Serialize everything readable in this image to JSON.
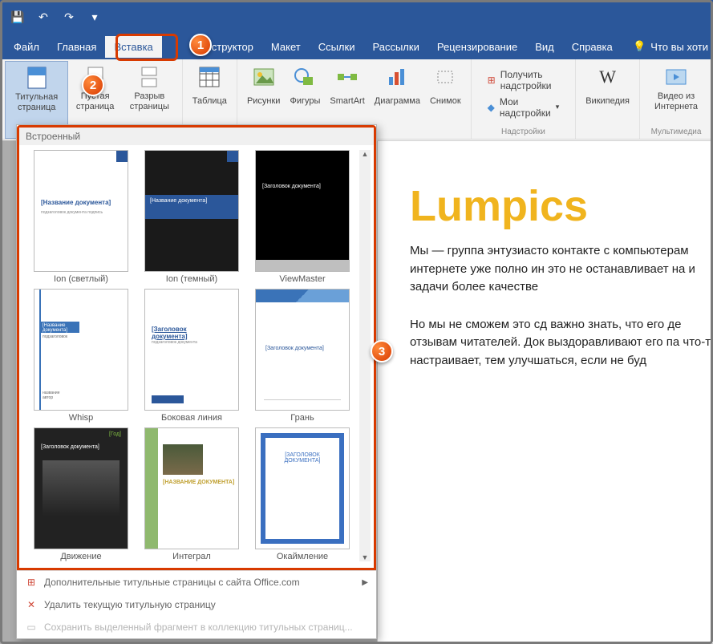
{
  "qat": {
    "save": "💾",
    "undo": "↶",
    "redo": "↷",
    "more": "▾"
  },
  "menu": {
    "file": "Файл",
    "home": "Главная",
    "insert": "Вставка",
    "design": "Конструктор",
    "layout": "Макет",
    "refs": "Ссылки",
    "mail": "Рассылки",
    "review": "Рецензирование",
    "view": "Вид",
    "help": "Справка",
    "tell": "Что вы хоти"
  },
  "ribbon": {
    "cover": "Титульная страница",
    "blank": "Пустая страница",
    "break": "Разрыв страницы",
    "table": "Таблица",
    "pics": "Рисунки",
    "shapes": "Фигуры",
    "smart": "SmartArt",
    "chart": "Диаграмма",
    "snap": "Снимок",
    "get": "Получить надстройки",
    "my": "Мои надстройки",
    "wiki": "Википедия",
    "video": "Видео из Интернета",
    "g_addins": "Надстройки",
    "g_media": "Мультимедиа"
  },
  "gallery": {
    "head": "Встроенный",
    "items": [
      {
        "cap": "Ion (светлый)",
        "t1": "[Название документа]"
      },
      {
        "cap": "Ion (темный)",
        "t1": "[Название документа]"
      },
      {
        "cap": "ViewMaster",
        "t1": "[Заголовок документа]"
      },
      {
        "cap": "Whisp",
        "t1": "[Название документа]"
      },
      {
        "cap": "Боковая линия",
        "t1": "[Заголовок документа]"
      },
      {
        "cap": "Грань",
        "t1": "[Заголовок документа]"
      },
      {
        "cap": "Движение",
        "t1": "[Заголовок документа]",
        "yr": "[Год]"
      },
      {
        "cap": "Интеграл",
        "t1": "[НАЗВАНИЕ ДОКУМЕНТА]"
      },
      {
        "cap": "Окаймление",
        "t1": "[ЗАГОЛОВОК ДОКУМЕНТА]"
      }
    ],
    "menu": {
      "more": "Дополнительные титульные страницы с сайта Office.com",
      "remove": "Удалить текущую титульную страницу",
      "save": "Сохранить выделенный фрагмент в коллекцию титульных страниц..."
    }
  },
  "doc": {
    "h": "Lumpics",
    "p1": "Мы — группа энтузиасто контакте с компьютерам интернете уже полно ин это не останавливает на и задачи более качестве",
    "p2": "Но мы не сможем это сд важно знать, что его де отзывам читателей. Док выздоравливают его па что-то настраивает, тем улучшаться, если не буд"
  },
  "markers": {
    "m1": "1",
    "m2": "2",
    "m3": "3"
  }
}
